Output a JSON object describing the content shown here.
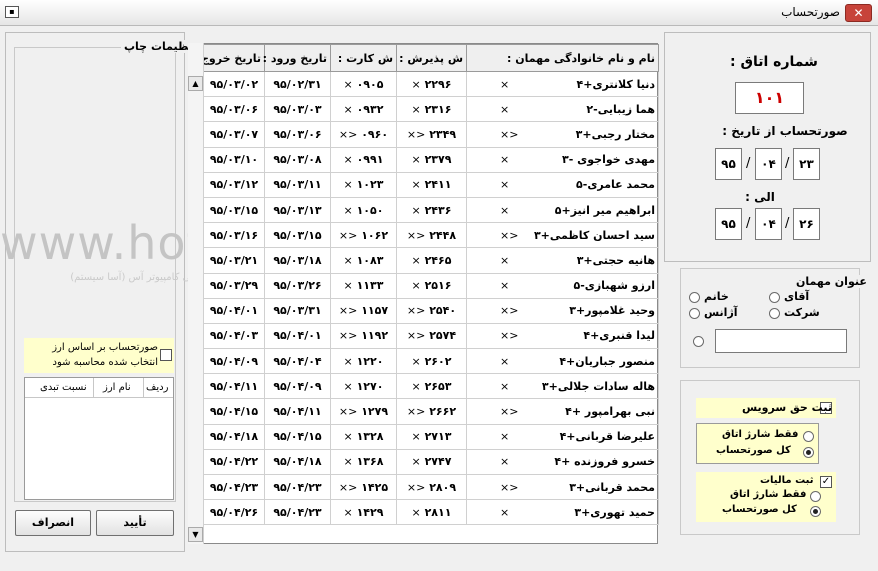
{
  "window": {
    "title": "صورتحساب",
    "close_label": "✕"
  },
  "print_settings": {
    "title": "تنظیمات چاپ"
  },
  "currency": {
    "checkbox_label": "صورتحساب بر اساس ارز انتخاب شده محاسبه شود",
    "columns": [
      "ردیف",
      "نام ارز",
      "نسبت تبدی"
    ]
  },
  "buttons": {
    "confirm": "تأیید",
    "cancel": "انصراف"
  },
  "grid": {
    "columns": [
      "نام و نام خانوادگی مهمان :",
      "ش پذیرش :",
      "ش کارت :",
      "تاریخ ورود :",
      "تاریخ خروج :"
    ],
    "rows": [
      {
        "name": "دنیا کلانتری+۴",
        "mark": "×",
        "reception": "۲۲۹۶",
        "rmark": "×",
        "card": "۰۹۰۵",
        "cmark": "×",
        "entry": "۹۵/۰۲/۳۱",
        "exit": "۹۵/۰۳/۰۲"
      },
      {
        "name": "هما زیبایی-۲",
        "mark": "×",
        "reception": "۲۳۱۶",
        "rmark": "×",
        "card": "۰۹۳۲",
        "cmark": "×",
        "entry": "۹۵/۰۳/۰۳",
        "exit": "۹۵/۰۳/۰۶"
      },
      {
        "name": "مختار رجبی+۳",
        "mark": "<×",
        "reception": "۲۳۴۹",
        "rmark": "<×",
        "card": "۰۹۶۰",
        "cmark": "<×",
        "entry": "۹۵/۰۳/۰۶",
        "exit": "۹۵/۰۳/۰۷"
      },
      {
        "name": "مهدی خواجوی -۳",
        "mark": "×",
        "reception": "۲۳۷۹",
        "rmark": "×",
        "card": "۰۹۹۱",
        "cmark": "×",
        "entry": "۹۵/۰۳/۰۸",
        "exit": "۹۵/۰۳/۱۰"
      },
      {
        "name": "محمد عامری-۵",
        "mark": "×",
        "reception": "۲۴۱۱",
        "rmark": "×",
        "card": "۱۰۲۳",
        "cmark": "×",
        "entry": "۹۵/۰۳/۱۱",
        "exit": "۹۵/۰۳/۱۲"
      },
      {
        "name": "ابراهیم میر انیز+۵",
        "mark": "×",
        "reception": "۲۴۳۶",
        "rmark": "×",
        "card": "۱۰۵۰",
        "cmark": "×",
        "entry": "۹۵/۰۳/۱۳",
        "exit": "۹۵/۰۳/۱۵"
      },
      {
        "name": "سید احسان کاظمی+۳",
        "mark": "<×",
        "reception": "۲۴۴۸",
        "rmark": "<×",
        "card": "۱۰۶۲",
        "cmark": "<×",
        "entry": "۹۵/۰۳/۱۵",
        "exit": "۹۵/۰۳/۱۶"
      },
      {
        "name": "هانیه حجتی+۳",
        "mark": "×",
        "reception": "۲۴۶۵",
        "rmark": "×",
        "card": "۱۰۸۳",
        "cmark": "×",
        "entry": "۹۵/۰۳/۱۸",
        "exit": "۹۵/۰۳/۲۱"
      },
      {
        "name": "ارزو شهبازی-۵",
        "mark": "×",
        "reception": "۲۵۱۶",
        "rmark": "×",
        "card": "۱۱۳۳",
        "cmark": "×",
        "entry": "۹۵/۰۳/۲۶",
        "exit": "۹۵/۰۳/۲۹"
      },
      {
        "name": "وحید غلامپور+۳",
        "mark": "<×",
        "reception": "۲۵۴۰",
        "rmark": "<×",
        "card": "۱۱۵۷",
        "cmark": "<×",
        "entry": "۹۵/۰۳/۳۱",
        "exit": "۹۵/۰۴/۰۱"
      },
      {
        "name": "لیدا قنبری+۴",
        "mark": "<×",
        "reception": "۲۵۷۴",
        "rmark": "<×",
        "card": "۱۱۹۲",
        "cmark": "<×",
        "entry": "۹۵/۰۴/۰۱",
        "exit": "۹۵/۰۴/۰۳"
      },
      {
        "name": "منصور جباریان+۴",
        "mark": "×",
        "reception": "۲۶۰۲",
        "rmark": "×",
        "card": "۱۲۲۰",
        "cmark": "×",
        "entry": "۹۵/۰۴/۰۴",
        "exit": "۹۵/۰۴/۰۹"
      },
      {
        "name": "هاله سادات جلالی+۳",
        "mark": "×",
        "reception": "۲۶۵۳",
        "rmark": "×",
        "card": "۱۲۷۰",
        "cmark": "×",
        "entry": "۹۵/۰۴/۰۹",
        "exit": "۹۵/۰۴/۱۱"
      },
      {
        "name": "نبی بهرامپور +۴",
        "mark": "<×",
        "reception": "۲۶۶۲",
        "rmark": "<×",
        "card": "۱۲۷۹",
        "cmark": "<×",
        "entry": "۹۵/۰۴/۱۱",
        "exit": "۹۵/۰۴/۱۵"
      },
      {
        "name": "علیرضا قربانی+۴",
        "mark": "×",
        "reception": "۲۷۱۳",
        "rmark": "×",
        "card": "۱۳۲۸",
        "cmark": "×",
        "entry": "۹۵/۰۴/۱۵",
        "exit": "۹۵/۰۴/۱۸"
      },
      {
        "name": "خسرو فروزنده +۴",
        "mark": "×",
        "reception": "۲۷۴۷",
        "rmark": "×",
        "card": "۱۳۶۸",
        "cmark": "×",
        "entry": "۹۵/۰۴/۱۸",
        "exit": "۹۵/۰۴/۲۲"
      },
      {
        "name": "محمد قربانی+۳",
        "mark": "<×",
        "reception": "۲۸۰۹",
        "rmark": "<×",
        "card": "۱۴۲۵",
        "cmark": "<×",
        "entry": "۹۵/۰۴/۲۳",
        "exit": "۹۵/۰۴/۲۳"
      },
      {
        "name": "حمید تهوری+۳",
        "mark": "×",
        "reception": "۲۸۱۱",
        "rmark": "×",
        "card": "۱۴۲۹",
        "cmark": "×",
        "entry": "۹۵/۰۴/۲۳",
        "exit": "۹۵/۰۴/۲۶"
      }
    ]
  },
  "room": {
    "label": "شماره اتاق :",
    "value": "۱۰۱"
  },
  "date_from": {
    "label": "صورتحساب از تاریخ :",
    "day": "۲۳",
    "month": "۰۴",
    "year": "۹۵"
  },
  "date_to": {
    "label": "الی :",
    "day": "۲۶",
    "month": "۰۴",
    "year": "۹۵"
  },
  "date_sep": "/",
  "guest_title": {
    "title": "عنوان مهمان",
    "options": [
      "آقای",
      "خانم",
      "شرکت",
      "آژانس"
    ]
  },
  "service": {
    "label": "ثبت حق سرویس",
    "options": [
      "فقط شارژ اتاق",
      "کل صورتحساب"
    ]
  },
  "tax": {
    "label": "ثبت مالیات",
    "options": [
      "فقط شارژ اتاق",
      "کل صورتحساب"
    ]
  },
  "watermark": {
    "url": "www.hotl.ir",
    "subtitle": "مرکز تخصصی کامپیوتر آس (آسا سیستم)"
  },
  "colors": {
    "room_number": "#cc0000",
    "close_button": "#c7433a",
    "highlight": "#ffffcc"
  }
}
